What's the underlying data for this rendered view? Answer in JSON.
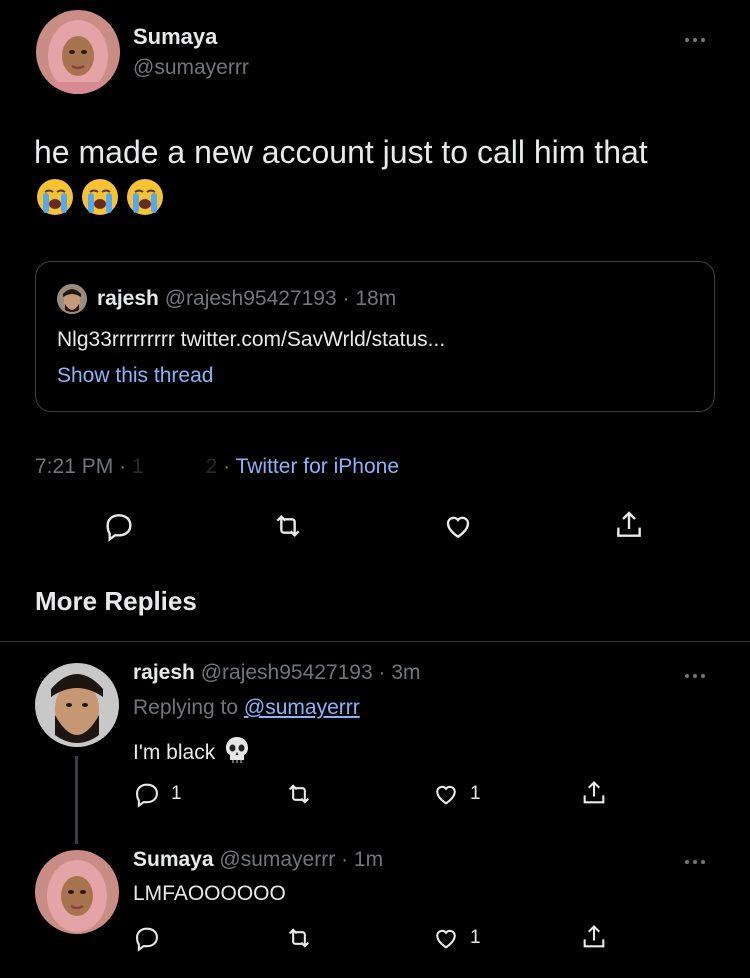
{
  "tweet": {
    "author": {
      "name": "Sumaya",
      "handle": "@sumayerrr"
    },
    "text": "he made a new account just to call him that",
    "emojis": [
      "loudly-crying-face",
      "loudly-crying-face",
      "loudly-crying-face"
    ],
    "quote": {
      "name": "rajesh",
      "handle": "@rajesh95427193",
      "sep": "·",
      "time": "18m",
      "text": "Nlg33rrrrrrrrr twitter.com/SavWrld/status...",
      "show_thread": "Show this thread"
    },
    "meta": {
      "time": "7:21 PM",
      "sep1": "·",
      "date": "1",
      "redacted": "2",
      "sep2": "·",
      "source": "Twitter for iPhone"
    }
  },
  "section_title": "More Replies",
  "replies": [
    {
      "name": "rajesh",
      "handle": "@rajesh95427193",
      "sep": "·",
      "time": "3m",
      "replying_prefix": "Replying to",
      "replying_handle": "@sumayerrr",
      "text": "I'm black",
      "emoji": "skull",
      "reply_count": "1",
      "like_count": "1"
    },
    {
      "name": "Sumaya",
      "handle": "@sumayerrr",
      "sep": "·",
      "time": "1m",
      "text": "LMFAOOOOOO",
      "like_count": "1"
    }
  ],
  "colors": {
    "background": "#000000",
    "text": "#e7e9ea",
    "muted": "#71767b",
    "link": "#8ab4f8",
    "divider": "#2f3336"
  }
}
